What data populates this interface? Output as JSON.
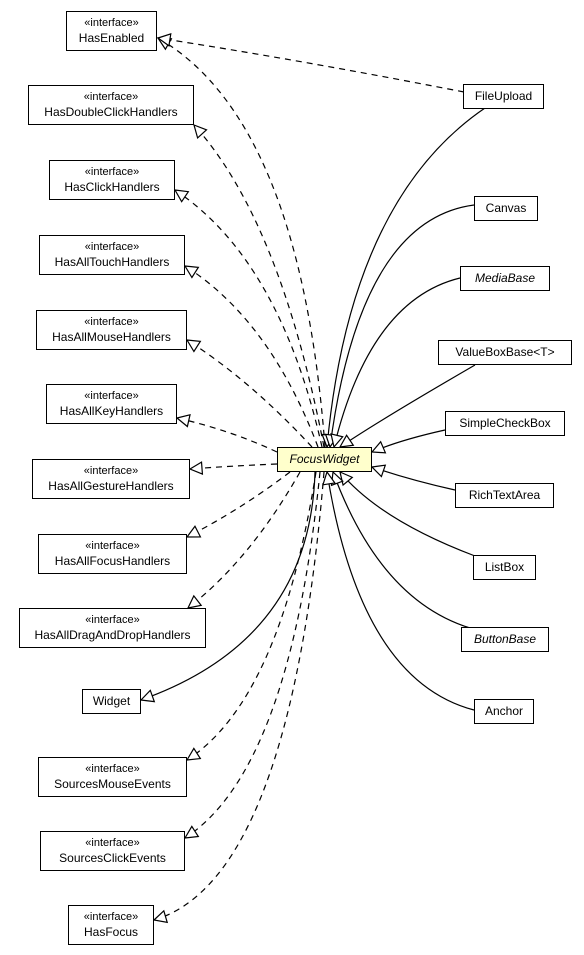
{
  "stereotype": "«interface»",
  "focus": {
    "name": "FocusWidget",
    "abstract": true,
    "fill": "#ffffcc"
  },
  "interfaces": [
    {
      "name": "HasEnabled"
    },
    {
      "name": "HasDoubleClickHandlers"
    },
    {
      "name": "HasClickHandlers"
    },
    {
      "name": "HasAllTouchHandlers"
    },
    {
      "name": "HasAllMouseHandlers"
    },
    {
      "name": "HasAllKeyHandlers"
    },
    {
      "name": "HasAllGestureHandlers"
    },
    {
      "name": "HasAllFocusHandlers"
    },
    {
      "name": "HasAllDragAndDropHandlers"
    },
    {
      "name": "SourcesMouseEvents"
    },
    {
      "name": "SourcesClickEvents"
    },
    {
      "name": "HasFocus"
    }
  ],
  "superclass": {
    "name": "Widget"
  },
  "subclasses": [
    {
      "name": "FileUpload",
      "abstract": false
    },
    {
      "name": "Canvas",
      "abstract": false
    },
    {
      "name": "MediaBase",
      "abstract": true
    },
    {
      "name": "ValueBoxBase<T>",
      "abstract": false
    },
    {
      "name": "SimpleCheckBox",
      "abstract": false
    },
    {
      "name": "RichTextArea",
      "abstract": false
    },
    {
      "name": "ListBox",
      "abstract": false
    },
    {
      "name": "ButtonBase",
      "abstract": true
    },
    {
      "name": "Anchor",
      "abstract": false
    }
  ]
}
